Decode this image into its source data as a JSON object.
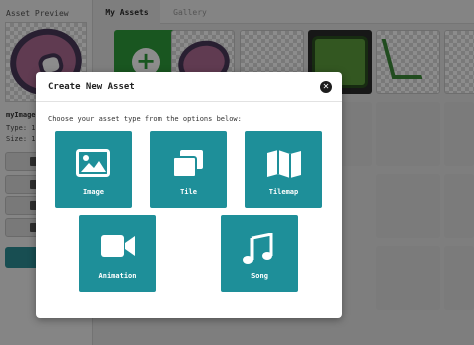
{
  "left_panel": {
    "title": "Asset Preview",
    "asset_name": "myImage",
    "type_label": "Type: 1",
    "size_label": "Size: 1",
    "buttons": [
      "",
      "D",
      "",
      ""
    ],
    "primary_button": ""
  },
  "tabs": [
    {
      "label": "My Assets",
      "active": true
    },
    {
      "label": "Gallery",
      "active": false
    }
  ],
  "modal": {
    "title": "Create New Asset",
    "subtitle": "Choose your asset type from the options below:",
    "close_icon": "close-icon",
    "options": [
      {
        "label": "Image",
        "icon": "image-icon"
      },
      {
        "label": "Tile",
        "icon": "tile-icon"
      },
      {
        "label": "Tilemap",
        "icon": "map-icon"
      },
      {
        "label": "Animation",
        "icon": "video-icon"
      },
      {
        "label": "Song",
        "icon": "music-note-icon"
      }
    ]
  },
  "colors": {
    "accent": "#1e8f99",
    "new_asset": "#2f9d3b",
    "overlay": "#000000"
  }
}
